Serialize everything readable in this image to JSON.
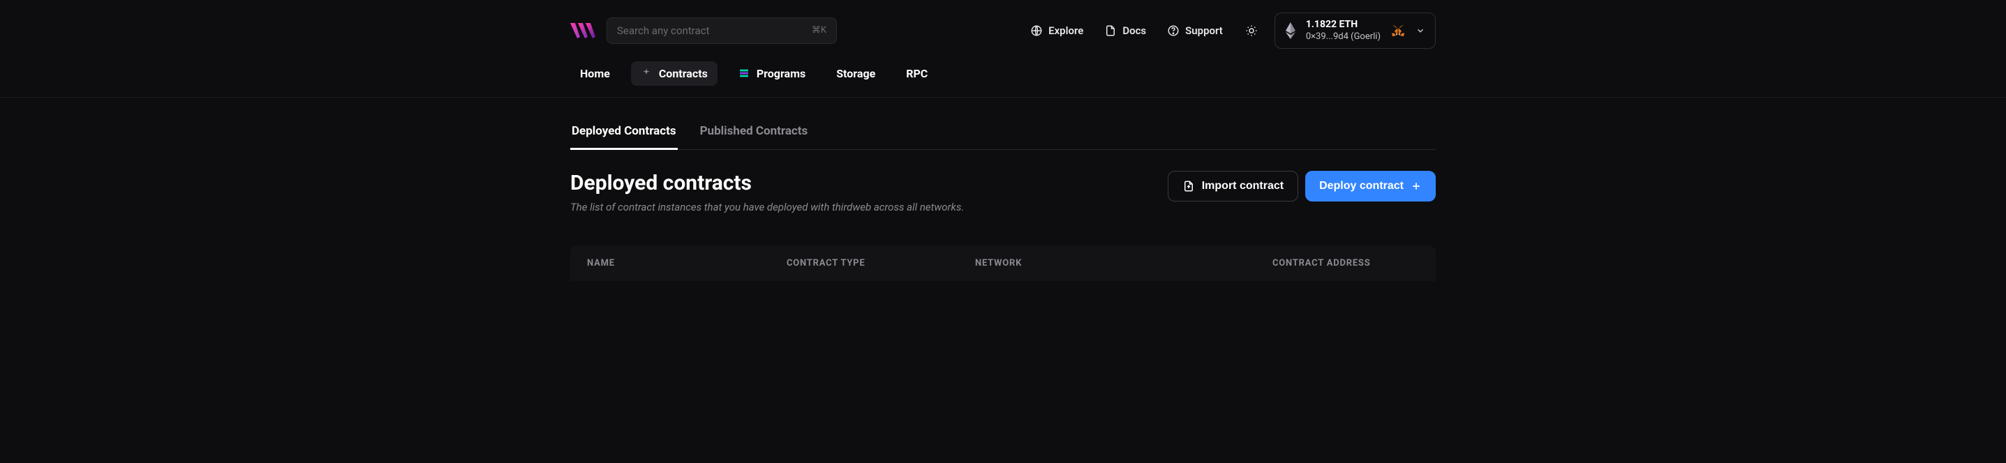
{
  "search": {
    "placeholder": "Search any contract",
    "shortcut": "⌘K"
  },
  "top_links": {
    "explore": "Explore",
    "docs": "Docs",
    "support": "Support"
  },
  "wallet": {
    "balance": "1.1822 ETH",
    "address": "0×39...9d4 (Goerli)"
  },
  "nav": {
    "home": "Home",
    "contracts": "Contracts",
    "programs": "Programs",
    "storage": "Storage",
    "rpc": "RPC"
  },
  "sub_tabs": {
    "deployed": "Deployed Contracts",
    "published": "Published Contracts"
  },
  "page": {
    "title": "Deployed contracts",
    "description": "The list of contract instances that you have deployed with thirdweb across all networks."
  },
  "actions": {
    "import": "Import contract",
    "deploy": "Deploy contract"
  },
  "table": {
    "columns": {
      "name": "NAME",
      "type": "CONTRACT TYPE",
      "network": "NETWORK",
      "address": "CONTRACT ADDRESS"
    }
  }
}
